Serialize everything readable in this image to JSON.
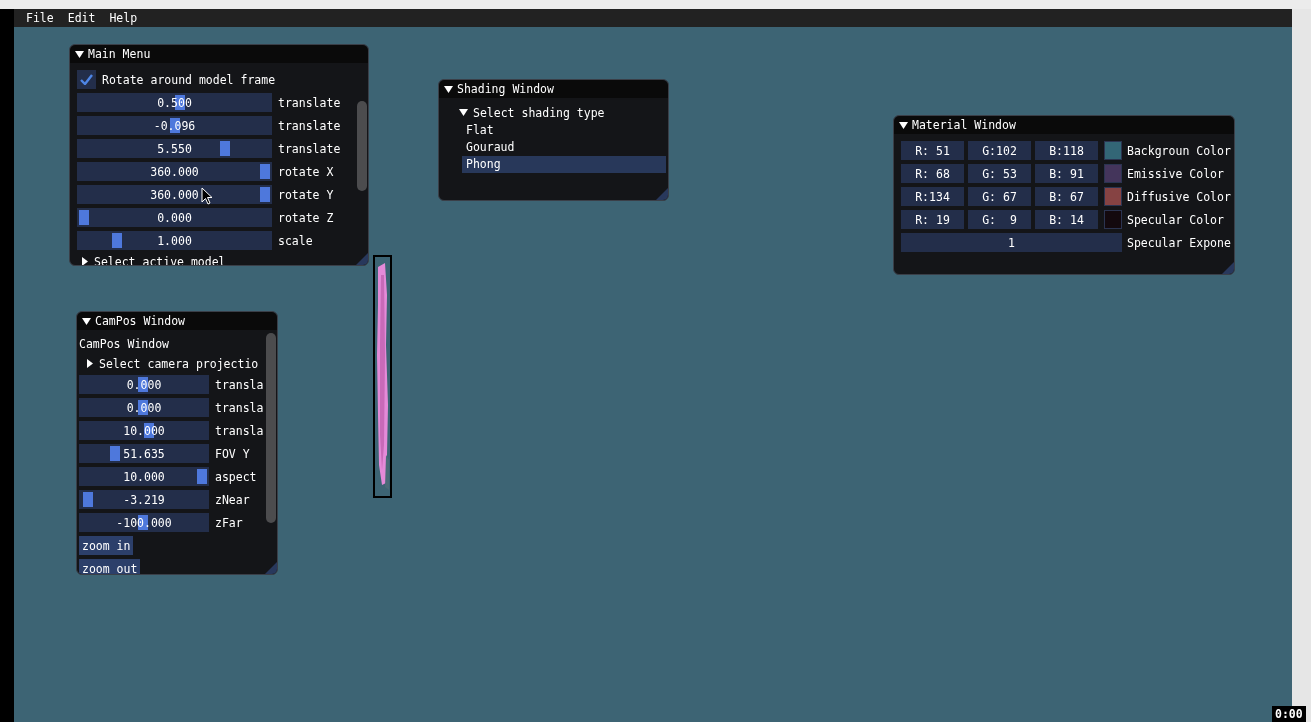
{
  "menubar": [
    {
      "label": "File"
    },
    {
      "label": "Edit"
    },
    {
      "label": "Help"
    }
  ],
  "main_menu": {
    "title": "Main Menu",
    "checkbox": {
      "label": "Rotate around model frame",
      "checked": true
    },
    "sliders": [
      {
        "value": "0.500",
        "label": "translate",
        "level": 0.53
      },
      {
        "value": "-0.096",
        "label": "translate",
        "level": 0.5
      },
      {
        "value": "5.550",
        "label": "translate",
        "level": 0.78
      },
      {
        "value": "360.000",
        "label": "rotate X",
        "level": 1
      },
      {
        "value": "360.000",
        "label": "rotate Y",
        "level": 1
      },
      {
        "value": "0.000",
        "label": "rotate Z",
        "level": 0
      },
      {
        "value": "1.000",
        "label": "scale",
        "level": 0.18
      }
    ],
    "tree_node": {
      "label": "Select active model",
      "expanded": false
    }
  },
  "shading_window": {
    "title": "Shading Window",
    "tree_node": {
      "label": "Select shading type",
      "expanded": true,
      "items": [
        {
          "label": "Flat",
          "selected": false
        },
        {
          "label": "Gouraud",
          "selected": false
        },
        {
          "label": "Phong",
          "selected": true
        }
      ]
    }
  },
  "material_window": {
    "title": "Material Window",
    "rows": [
      {
        "fields": [
          "R: 51",
          "G:102",
          "B:118"
        ],
        "color": "#336676",
        "label": "Backgroun Color"
      },
      {
        "fields": [
          "R: 68",
          "G: 53",
          "B: 91"
        ],
        "color": "#44355b",
        "label": "Emissive Color"
      },
      {
        "fields": [
          "R:134",
          "G: 67",
          "B: 67"
        ],
        "color": "#864343",
        "label": "Diffusive Color"
      },
      {
        "fields": [
          "R: 19",
          "G:  9",
          "B: 14"
        ],
        "color": "#13090e",
        "label": "Specular Color"
      }
    ],
    "exponent": {
      "value": "1",
      "label": "Specular Expone"
    }
  },
  "campos_window": {
    "title": "CamPos Window",
    "text": "CamPos Window",
    "tree_node": {
      "label": "Select camera projectio",
      "expanded": false
    },
    "sliders": [
      {
        "value": "0.000",
        "label": "transla",
        "level": 0.49
      },
      {
        "value": "0.000",
        "label": "transla",
        "level": 0.49
      },
      {
        "value": "10.000",
        "label": "transla",
        "level": 0.54
      },
      {
        "value": "51.635",
        "label": "FOV Y",
        "level": 0.25
      },
      {
        "value": "10.000",
        "label": "aspect",
        "level": 1
      },
      {
        "value": "-3.219",
        "label": "zNear",
        "level": 0.02
      },
      {
        "value": "-100.000",
        "label": "zFar",
        "level": 0.49
      }
    ],
    "buttons": [
      {
        "label": "zoom in"
      },
      {
        "label": "zoom out"
      }
    ]
  },
  "timer": "0:00"
}
